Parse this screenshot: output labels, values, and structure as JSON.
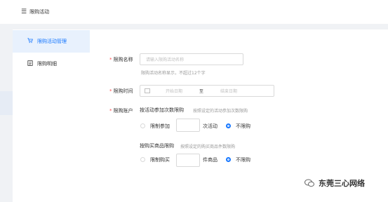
{
  "header": {
    "title": "限购活动",
    "menu_icon": "menu-icon"
  },
  "sidebar": {
    "items": [
      {
        "label": "限购活动管理",
        "icon": "cart-icon",
        "active": true
      },
      {
        "label": "限购明细",
        "icon": "list-icon",
        "active": false
      }
    ]
  },
  "form": {
    "name": {
      "label": "限购名称",
      "placeholder": "请输入限购活动名称",
      "hint": "限购活动名称显示，不超过12个字"
    },
    "time": {
      "label": "限购时间",
      "start_placeholder": "开始日期",
      "separator": "至",
      "end_placeholder": "结束日期"
    },
    "accounts": {
      "label": "限购账户",
      "by_activity": {
        "title": "按活动参加次数限购",
        "desc": "按照设定的活动参加次数限购",
        "limit_label": "限制参加",
        "unit": "次活动",
        "nolimit_label": "不限购",
        "selected": "不限购"
      },
      "by_item": {
        "title": "按购买商品限购",
        "desc": "按照设定的购买商品件数限购",
        "limit_label": "限制购买",
        "unit": "件商品",
        "nolimit_label": "不限购",
        "selected": "不限购"
      }
    }
  },
  "watermark": {
    "text": "东莞三心网络"
  },
  "colors": {
    "accent": "#1677ff",
    "required": "#ff4d4f",
    "active_bg": "#e8f1fd"
  }
}
